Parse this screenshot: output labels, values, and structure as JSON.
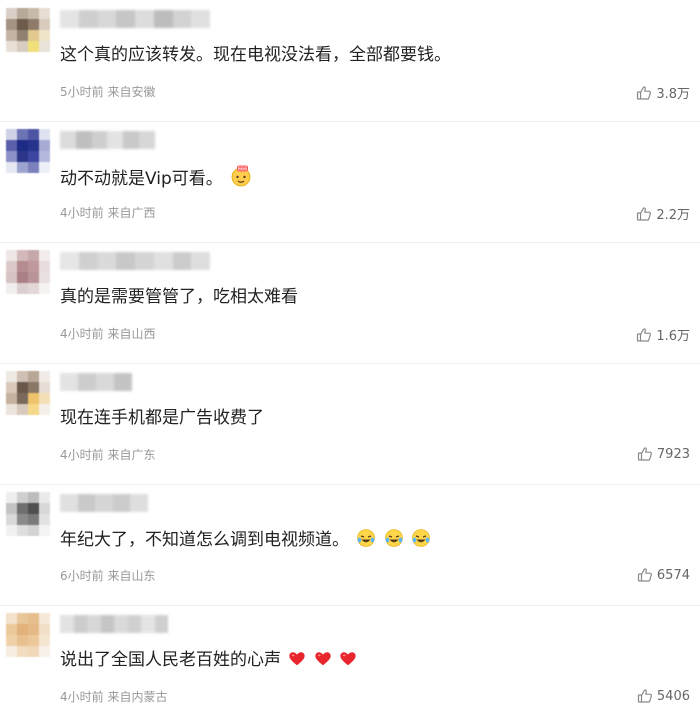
{
  "comments": [
    {
      "text": "这个真的应该转发。现在电视没法看，全部都要钱。",
      "time": "5小时前",
      "location": "来自安徽",
      "likes": "3.8万",
      "emoji": [],
      "avatar_colors": [
        "#d8cfc6",
        "#b7a898",
        "#c9b9a9",
        "#e6ddd3",
        "#a49282",
        "#6d5a49",
        "#8e7b69",
        "#d9cbbd",
        "#c3b3a3",
        "#8f806f",
        "#e2c98e",
        "#f0e4c8",
        "#e8e0d6",
        "#d6ccc0",
        "#f1e07a",
        "#eae3da"
      ],
      "name_colors": [
        "#e4e4e4",
        "#cfcfcf",
        "#d8d8d8",
        "#c6c6c6",
        "#dcdcdc",
        "#bdbdbd",
        "#d2d2d2",
        "#e0e0e0"
      ]
    },
    {
      "text": "动不动就是Vip可看。",
      "time": "4小时前",
      "location": "来自广西",
      "likes": "2.2万",
      "emoji": [
        "666-face-emoji"
      ],
      "avatar_colors": [
        "#cfd2e6",
        "#6c74b6",
        "#4d56a5",
        "#dfe2f0",
        "#5960a9",
        "#1d2a86",
        "#28338c",
        "#a6abd3",
        "#8c92c7",
        "#2b3689",
        "#3c46a0",
        "#b3b8dc",
        "#e6e8f3",
        "#9da3cf",
        "#7a81bd",
        "#eef0f7"
      ],
      "name_colors": [
        "#dcdcdc",
        "#bfbfbf",
        "#cfcfcf",
        "#e3e3e3",
        "#c9c9c9",
        "#d7d7d7"
      ]
    },
    {
      "text": "真的是需要管管了，吃相太难看",
      "time": "4小时前",
      "location": "来自山西",
      "likes": "1.6万",
      "emoji": [],
      "avatar_colors": [
        "#efe6e6",
        "#d3b9bb",
        "#c6a8aa",
        "#f2ecec",
        "#dcc9ca",
        "#b58c90",
        "#c0999c",
        "#e8dcdd",
        "#d6c3c4",
        "#a98086",
        "#b89499",
        "#e9e0e1",
        "#f3eeee",
        "#dccfd0",
        "#e4d7d8",
        "#f6f2f2"
      ],
      "name_colors": [
        "#e6e6e6",
        "#d0d0d0",
        "#dadada",
        "#c8c8c8",
        "#d4d4d4",
        "#e0e0e0",
        "#cccccc",
        "#dedede"
      ]
    },
    {
      "text": "现在连手机都是广告收费了",
      "time": "4小时前",
      "location": "来自广东",
      "likes": "7923",
      "emoji": [],
      "avatar_colors": [
        "#efe9e3",
        "#cfc0b3",
        "#b8a697",
        "#f0ebe6",
        "#d9c9bb",
        "#6a584b",
        "#8b7766",
        "#e6ddd5",
        "#c6b19e",
        "#7b6a5c",
        "#efc36c",
        "#f3dfb6",
        "#ebe4dd",
        "#d8cabd",
        "#f6d889",
        "#f4efe9"
      ],
      "name_colors": [
        "#e3e3e3",
        "#cdcdcd",
        "#d9d9d9",
        "#c4c4c4"
      ]
    },
    {
      "text": "年纪大了，不知道怎么调到电视频道。",
      "time": "6小时前",
      "location": "来自山东",
      "likes": "6574",
      "emoji": [
        "laughing-tears-emoji",
        "laughing-tears-emoji",
        "laughing-tears-emoji"
      ],
      "avatar_colors": [
        "#eeeeee",
        "#cfcfcf",
        "#bdbdbd",
        "#eaeaea",
        "#c4c4c4",
        "#6f6f6f",
        "#4f4f4f",
        "#d8d8d8",
        "#d9d9d9",
        "#8a8a8a",
        "#7a7a7a",
        "#e2e2e2",
        "#f1f1f1",
        "#dedede",
        "#d3d3d3",
        "#f4f4f4"
      ],
      "name_colors": [
        "#e0e0e0",
        "#c9c9c9",
        "#d5d5d5",
        "#cccccc",
        "#dedede"
      ]
    },
    {
      "text": "说出了全国人民老百姓的心声",
      "time": "4小时前",
      "location": "来自内蒙古",
      "likes": "5406",
      "emoji": [
        "red-heart-emoji",
        "red-heart-emoji",
        "red-heart-emoji"
      ],
      "avatar_colors": [
        "#f3e2cc",
        "#e9c79b",
        "#e7bf8d",
        "#f5e8d8",
        "#ecc999",
        "#e1b27a",
        "#e5b985",
        "#f2dfc7",
        "#eed1a8",
        "#e9c090",
        "#ecc89b",
        "#f5e6d2",
        "#f7eee2",
        "#f1dcc0",
        "#f0d8b8",
        "#f8f1e8"
      ],
      "name_colors": [
        "#e2e2e2",
        "#cccccc",
        "#d7d7d7",
        "#c5c5c5",
        "#dadada",
        "#d0d0d0",
        "#e4e4e4",
        "#cfcfcf"
      ]
    }
  ],
  "icons": {
    "like": "thumbs-up-icon"
  },
  "colors": {
    "meta": "#999999",
    "text": "#222222",
    "divider": "#eeeeee"
  }
}
